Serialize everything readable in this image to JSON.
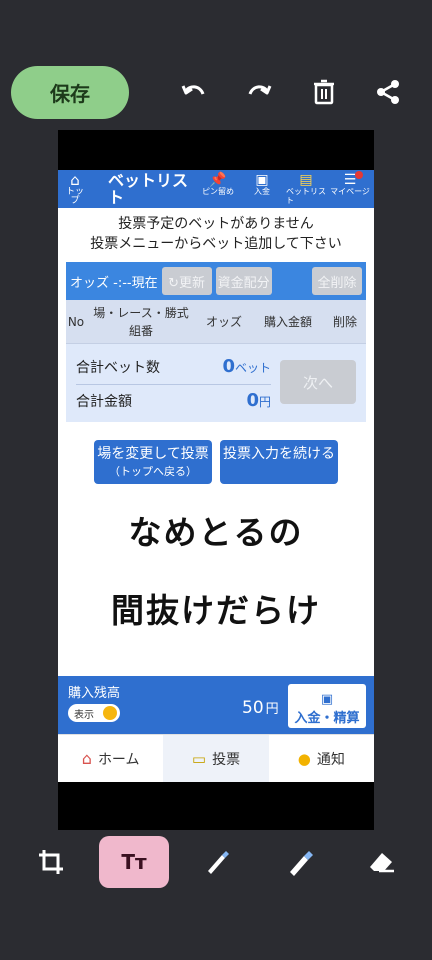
{
  "editor": {
    "save_label": "保存",
    "tools_top": [
      "undo-icon",
      "redo-icon",
      "trash-icon",
      "share-icon"
    ],
    "tools_bottom": [
      "crop-icon",
      "text-icon",
      "pen-icon",
      "highlighter-icon",
      "eraser-icon"
    ],
    "text_tool_label": "Tт",
    "accent_save": "#8fce8a",
    "accent_text_tool": "#f0b8cc"
  },
  "app": {
    "header": {
      "home_label": "トップ",
      "title": "ベットリスト",
      "icons": [
        {
          "icon": "pin-icon",
          "label": "ピン留め"
        },
        {
          "icon": "deposit-icon",
          "label": "入金"
        },
        {
          "icon": "betlist-icon",
          "label": "ベットリスト"
        },
        {
          "icon": "menu-icon",
          "label": "マイページ"
        }
      ]
    },
    "message_line1": "投票予定のベットがありません",
    "message_line2": "投票メニューからベット追加して下さい",
    "odds": {
      "label": "オッズ -:--現在",
      "refresh": "↻更新",
      "allocate": "資金配分",
      "clear_all": "全削除"
    },
    "columns": {
      "no": "No",
      "race": "場・レース・勝式",
      "combo": "組番",
      "odds": "オッズ",
      "amount": "購入金額",
      "delete": "削除"
    },
    "summary": {
      "bet_count_label": "合計ベット数",
      "bet_count_value": "0",
      "bet_count_unit": "ベット",
      "total_label": "合計金額",
      "total_value": "0",
      "total_unit": "円",
      "next_label": "次へ"
    },
    "buttons": {
      "change_venue": "場を変更して投票",
      "change_venue_sub": "（トップへ戻る）",
      "continue_input": "投票入力を続ける"
    },
    "overlay_line1": "なめとるの",
    "overlay_line2": "間抜けだらけ",
    "balance": {
      "label": "購入残高",
      "toggle_label": "表示",
      "value": "50",
      "unit": "円",
      "deposit_button": "入金・精算"
    },
    "nav": [
      {
        "icon": "house-icon",
        "label": "ホーム"
      },
      {
        "icon": "ticket-icon",
        "label": "投票"
      },
      {
        "icon": "bell-icon",
        "label": "通知"
      }
    ],
    "brand_color": "#2f6fcf"
  }
}
